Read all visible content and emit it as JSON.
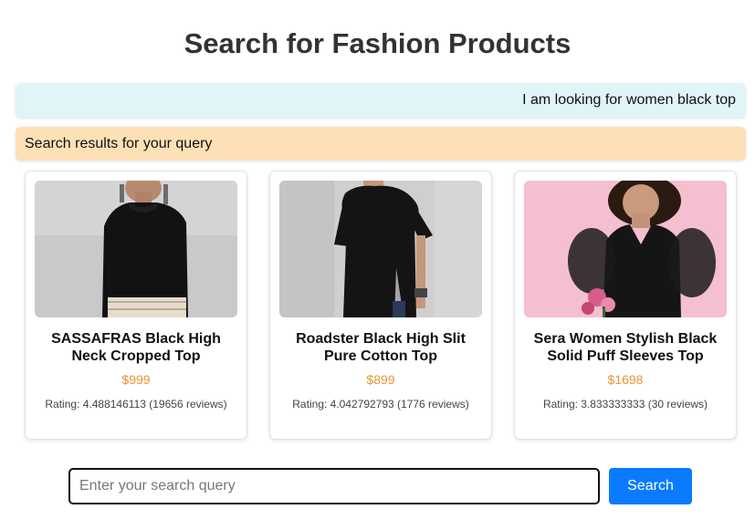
{
  "page": {
    "title": "Search for Fashion Products"
  },
  "chat": {
    "user_message": "I am looking for women black top",
    "bot_message": "Search results for your query"
  },
  "products": [
    {
      "name": "SASSAFRAS Black High Neck Cropped Top",
      "price": "$999",
      "rating": "Rating: 4.488146113 (19656 reviews)"
    },
    {
      "name": "Roadster Black High Slit Pure Cotton Top",
      "price": "$899",
      "rating": "Rating: 4.042792793 (1776 reviews)"
    },
    {
      "name": "Sera Women Stylish Black Solid Puff Sleeves Top",
      "price": "$1698",
      "rating": "Rating: 3.833333333 (30 reviews)"
    }
  ],
  "search": {
    "placeholder": "Enter your search query",
    "value": "",
    "button_label": "Search"
  },
  "colors": {
    "user_bubble": "#dff5f8",
    "bot_bubble": "#fde0b6",
    "price": "#e8962e",
    "button": "#0a7bff"
  }
}
